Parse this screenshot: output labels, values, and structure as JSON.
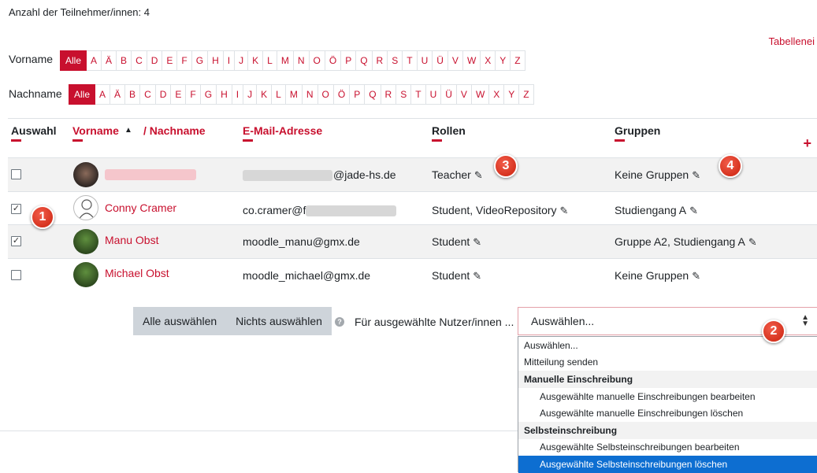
{
  "participants_count": "Anzahl der Teilnehmer/innen: 4",
  "reset_link": "Tabellenei",
  "firstname_bar": {
    "label": "Vorname",
    "letters": [
      "Alle",
      "A",
      "Ä",
      "B",
      "C",
      "D",
      "E",
      "F",
      "G",
      "H",
      "I",
      "J",
      "K",
      "L",
      "M",
      "N",
      "O",
      "Ö",
      "P",
      "Q",
      "R",
      "S",
      "T",
      "U",
      "Ü",
      "V",
      "W",
      "X",
      "Y",
      "Z"
    ]
  },
  "lastname_bar": {
    "label": "Nachname",
    "letters": [
      "Alle",
      "A",
      "Ä",
      "B",
      "C",
      "D",
      "E",
      "F",
      "G",
      "H",
      "I",
      "J",
      "K",
      "L",
      "M",
      "N",
      "O",
      "Ö",
      "P",
      "Q",
      "R",
      "S",
      "T",
      "U",
      "Ü",
      "V",
      "W",
      "X",
      "Y",
      "Z"
    ]
  },
  "table": {
    "headers": {
      "select": "Auswahl",
      "firstname": "Vorname",
      "sort_arrow": "▲",
      "lastname": "/ Nachname",
      "email": "E-Mail-Adresse",
      "roles": "Rollen",
      "groups": "Gruppen"
    },
    "rows": [
      {
        "checked": false,
        "name": "",
        "email": "@jade-hs.de",
        "roles": "Teacher",
        "groups": "Keine Gruppen"
      },
      {
        "checked": true,
        "name": "Conny Cramer",
        "email": "co.cramer@f",
        "roles": "Student, VideoRepository",
        "groups": "Studiengang A"
      },
      {
        "checked": true,
        "name": "Manu Obst",
        "email": "moodle_manu@gmx.de",
        "roles": "Student",
        "groups": "Gruppe A2, Studiengang A"
      },
      {
        "checked": false,
        "name": "Michael Obst",
        "email": "moodle_michael@gmx.de",
        "roles": "Student",
        "groups": "Keine Gruppen"
      }
    ]
  },
  "bulk": {
    "select_all": "Alle auswählen",
    "select_none": "Nichts auswählen",
    "help": "?",
    "for_selected": "Für ausgewählte Nutzer/innen ...",
    "select_value": "Auswählen..."
  },
  "dropdown_options": [
    {
      "label": "Auswählen...",
      "kind": "option"
    },
    {
      "label": "Mitteilung senden",
      "kind": "option"
    },
    {
      "label": "Manuelle Einschreibung",
      "kind": "group"
    },
    {
      "label": "Ausgewählte manuelle Einschreibungen bearbeiten",
      "kind": "sub"
    },
    {
      "label": "Ausgewählte manuelle Einschreibungen löschen",
      "kind": "sub"
    },
    {
      "label": "Selbsteinschreibung",
      "kind": "group"
    },
    {
      "label": "Ausgewählte Selbsteinschreibungen bearbeiten",
      "kind": "sub"
    },
    {
      "label": "Ausgewählte Selbsteinschreibungen löschen",
      "kind": "sub-selected"
    }
  ],
  "badges": [
    "1",
    "2",
    "3",
    "4"
  ],
  "icons": {
    "pencil": "pencil-icon",
    "check": "✓",
    "plus": "+"
  },
  "colors": {
    "accent": "#c8102e",
    "selected_option": "#0d6ed1",
    "badge": "#d6331f"
  }
}
